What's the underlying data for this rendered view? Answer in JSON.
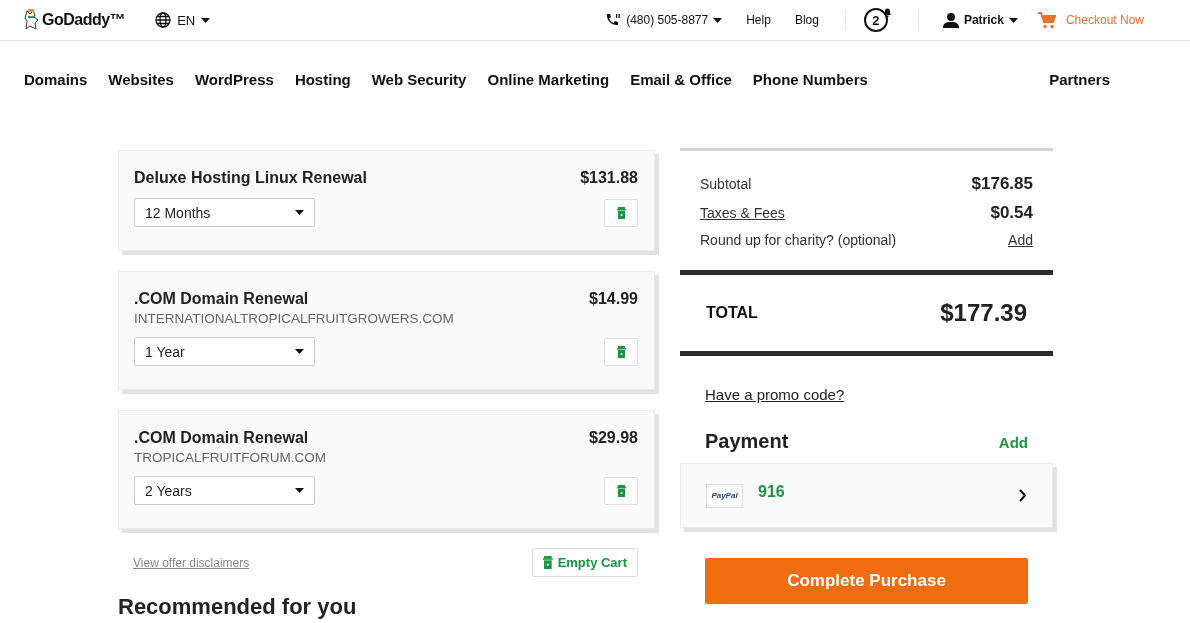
{
  "header": {
    "logo": "GoDaddy™",
    "language": "EN",
    "phone": "(480) 505-8877",
    "links": [
      "Help",
      "Blog"
    ],
    "notifications": "2",
    "user": "Patrick",
    "checkout": "Checkout Now"
  },
  "nav": {
    "items": [
      "Domains",
      "Websites",
      "WordPress",
      "Hosting",
      "Web Security",
      "Online Marketing",
      "Email & Office",
      "Phone Numbers"
    ],
    "partners": "Partners"
  },
  "cart": {
    "items": [
      {
        "name": "Deluxe Hosting Linux Renewal",
        "price": "$131.88",
        "term": "12 Months"
      },
      {
        "name": ".COM Domain Renewal",
        "domain": "INTERNATIONALTROPICALFRUITGROWERS.COM",
        "price": "$14.99",
        "term": "1 Year"
      },
      {
        "name": ".COM Domain Renewal",
        "domain": "TROPICALFRUITFORUM.COM",
        "price": "$29.98",
        "term": "2 Years"
      }
    ],
    "disclaimers": "View offer disclaimers",
    "empty_cart": "Empty Cart"
  },
  "recommended_title": "Recommended for you",
  "summary": {
    "subtotal_label": "Subtotal",
    "subtotal": "$176.85",
    "taxes_label": "Taxes & Fees",
    "taxes": "$0.54",
    "charity_label": "Round up for charity? (optional)",
    "charity_action": "Add",
    "total_label": "TOTAL",
    "total": "$177.39",
    "promo": "Have a promo code?"
  },
  "payment": {
    "title": "Payment",
    "add": "Add",
    "method_logo": "PayPal",
    "method_id": "916",
    "complete": "Complete Purchase"
  }
}
